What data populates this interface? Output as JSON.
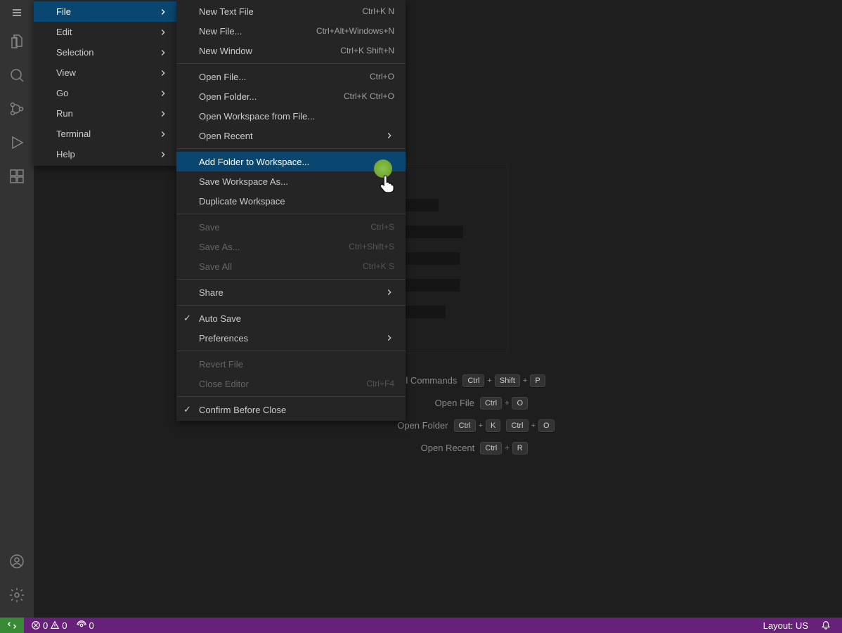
{
  "appMenu": {
    "items": [
      {
        "label": "File",
        "hasSub": true,
        "selected": true
      },
      {
        "label": "Edit",
        "hasSub": true
      },
      {
        "label": "Selection",
        "hasSub": true
      },
      {
        "label": "View",
        "hasSub": true
      },
      {
        "label": "Go",
        "hasSub": true
      },
      {
        "label": "Run",
        "hasSub": true
      },
      {
        "label": "Terminal",
        "hasSub": true
      },
      {
        "label": "Help",
        "hasSub": true
      }
    ]
  },
  "fileMenu": {
    "groups": [
      [
        {
          "label": "New Text File",
          "shortcut": "Ctrl+K N"
        },
        {
          "label": "New File...",
          "shortcut": "Ctrl+Alt+Windows+N"
        },
        {
          "label": "New Window",
          "shortcut": "Ctrl+K Shift+N"
        }
      ],
      [
        {
          "label": "Open File...",
          "shortcut": "Ctrl+O"
        },
        {
          "label": "Open Folder...",
          "shortcut": "Ctrl+K Ctrl+O"
        },
        {
          "label": "Open Workspace from File..."
        },
        {
          "label": "Open Recent",
          "hasSub": true
        }
      ],
      [
        {
          "label": "Add Folder to Workspace...",
          "selected": true
        },
        {
          "label": "Save Workspace As..."
        },
        {
          "label": "Duplicate Workspace"
        }
      ],
      [
        {
          "label": "Save",
          "shortcut": "Ctrl+S",
          "disabled": true
        },
        {
          "label": "Save As...",
          "shortcut": "Ctrl+Shift+S",
          "disabled": true
        },
        {
          "label": "Save All",
          "shortcut": "Ctrl+K S",
          "disabled": true
        }
      ],
      [
        {
          "label": "Share",
          "hasSub": true
        }
      ],
      [
        {
          "label": "Auto Save",
          "checked": true
        },
        {
          "label": "Preferences",
          "hasSub": true
        }
      ],
      [
        {
          "label": "Revert File",
          "disabled": true
        },
        {
          "label": "Close Editor",
          "shortcut": "Ctrl+F4",
          "disabled": true
        }
      ],
      [
        {
          "label": "Confirm Before Close",
          "checked": true
        }
      ]
    ]
  },
  "welcome": {
    "shortcuts": [
      {
        "label": "Show All Commands",
        "keys": [
          "Ctrl",
          "Shift",
          "P"
        ]
      },
      {
        "label": "Open File",
        "keys": [
          "Ctrl",
          "O"
        ]
      },
      {
        "label": "Open Folder",
        "keys": [
          "Ctrl",
          "K",
          "Ctrl",
          "O"
        ]
      },
      {
        "label": "Open Recent",
        "keys": [
          "Ctrl",
          "R"
        ]
      }
    ]
  },
  "status": {
    "errors": "0",
    "warnings": "0",
    "ports": "0",
    "layout": "Layout: US"
  }
}
